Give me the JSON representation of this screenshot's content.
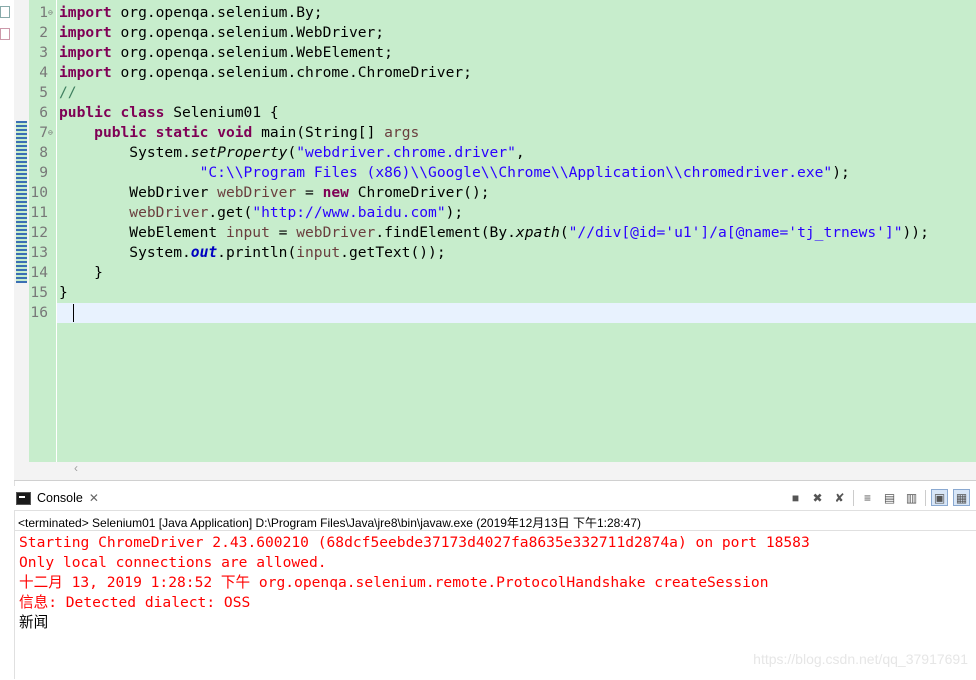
{
  "editor": {
    "lines": [
      {
        "n": "1",
        "t": [
          [
            "kw",
            "import"
          ],
          [
            "",
            "org.openqa.selenium.By;"
          ]
        ]
      },
      {
        "n": "2",
        "t": [
          [
            "kw",
            "import"
          ],
          [
            "",
            "org.openqa.selenium.WebDriver;"
          ]
        ]
      },
      {
        "n": "3",
        "t": [
          [
            "kw",
            "import"
          ],
          [
            "",
            "org.openqa.selenium.WebElement;"
          ]
        ]
      },
      {
        "n": "4",
        "t": [
          [
            "kw",
            "import"
          ],
          [
            "",
            "org.openqa.selenium.chrome.ChromeDriver;"
          ]
        ]
      },
      {
        "n": "5",
        "t": [
          [
            "cmt",
            "//"
          ]
        ]
      },
      {
        "n": "6",
        "t": [
          [
            "kw",
            "public"
          ],
          [
            "",
            " "
          ],
          [
            "kw",
            "class"
          ],
          [
            "",
            " Selenium01 {"
          ]
        ]
      },
      {
        "n": "7",
        "t": [
          [
            "",
            "    "
          ],
          [
            "kw",
            "public"
          ],
          [
            "",
            " "
          ],
          [
            "kw",
            "static"
          ],
          [
            "",
            " "
          ],
          [
            "kw",
            "void"
          ],
          [
            "",
            " main(String[] "
          ],
          [
            "var",
            "args"
          ],
          [
            ") {"
          ]
        ]
      },
      {
        "n": "8",
        "t": [
          [
            "",
            "        System."
          ],
          [
            "it",
            "setProperty"
          ],
          [
            "",
            "("
          ],
          [
            "str",
            "\"webdriver.chrome.driver\""
          ],
          [
            "",
            ","
          ]
        ]
      },
      {
        "n": "9",
        "t": [
          [
            "",
            "                "
          ],
          [
            "str",
            "\"C:\\\\Program Files (x86)\\\\Google\\\\Chrome\\\\Application\\\\chromedriver.exe\""
          ],
          [
            "",
            ");"
          ]
        ]
      },
      {
        "n": "10",
        "t": [
          [
            "",
            "        WebDriver "
          ],
          [
            "var",
            "webDriver"
          ],
          [
            "",
            " = "
          ],
          [
            "kw",
            "new"
          ],
          [
            "",
            " ChromeDriver();"
          ]
        ]
      },
      {
        "n": "11",
        "t": [
          [
            "",
            "        "
          ],
          [
            "var",
            "webDriver"
          ],
          [
            "",
            ".get("
          ],
          [
            "str",
            "\"http://www.baidu.com\""
          ],
          [
            "",
            ");"
          ]
        ]
      },
      {
        "n": "12",
        "t": [
          [
            "",
            "        WebElement "
          ],
          [
            "var",
            "input"
          ],
          [
            "",
            " = "
          ],
          [
            "var",
            "webDriver"
          ],
          [
            "",
            ".findElement(By."
          ],
          [
            "it",
            "xpath"
          ],
          [
            "",
            "("
          ],
          [
            "str",
            "\"//div[@id='u1']/a[@name='tj_trnews']\""
          ],
          [
            "",
            "));"
          ]
        ]
      },
      {
        "n": "13",
        "t": [
          [
            "",
            "        System."
          ],
          [
            "fld",
            "out"
          ],
          [
            "",
            ".println("
          ],
          [
            "var",
            "input"
          ],
          [
            "",
            ".getText());"
          ]
        ]
      },
      {
        "n": "14",
        "t": [
          [
            "",
            "    }"
          ]
        ]
      },
      {
        "n": "15",
        "t": [
          [
            "",
            "}"
          ]
        ]
      },
      {
        "n": "16",
        "t": []
      }
    ],
    "fold_markers": {
      "1": "⊖",
      "7": "⊖"
    }
  },
  "console": {
    "tab_label": "Console",
    "close_symbol": "✕",
    "status": "<terminated> Selenium01 [Java Application] D:\\Program Files\\Java\\jre8\\bin\\javaw.exe (2019年12月13日 下午1:28:47)",
    "output": [
      {
        "cls": "err",
        "text": "Starting ChromeDriver 2.43.600210 (68dcf5eebde37173d4027fa8635e332711d2874a) on port 18583"
      },
      {
        "cls": "err",
        "text": "Only local connections are allowed."
      },
      {
        "cls": "err",
        "text": "十二月 13, 2019 1:28:52 下午 org.openqa.selenium.remote.ProtocolHandshake createSession"
      },
      {
        "cls": "err",
        "text": "信息: Detected dialect: OSS"
      },
      {
        "cls": "std",
        "text": "新闻"
      }
    ],
    "toolbar": [
      "terminate-icon",
      "remove-launch-icon",
      "remove-all-terminated-icon",
      "scroll-lock-icon",
      "show-on-stdout-icon",
      "show-on-stderr-icon",
      "pin-console-icon",
      "display-selected-console-icon"
    ]
  },
  "watermark": "https://blog.csdn.net/qq_37917691",
  "colors": {
    "editor_bg": "#c7edcc",
    "keyword": "#7f0055",
    "string": "#2a00ff",
    "error": "#ff0000"
  }
}
